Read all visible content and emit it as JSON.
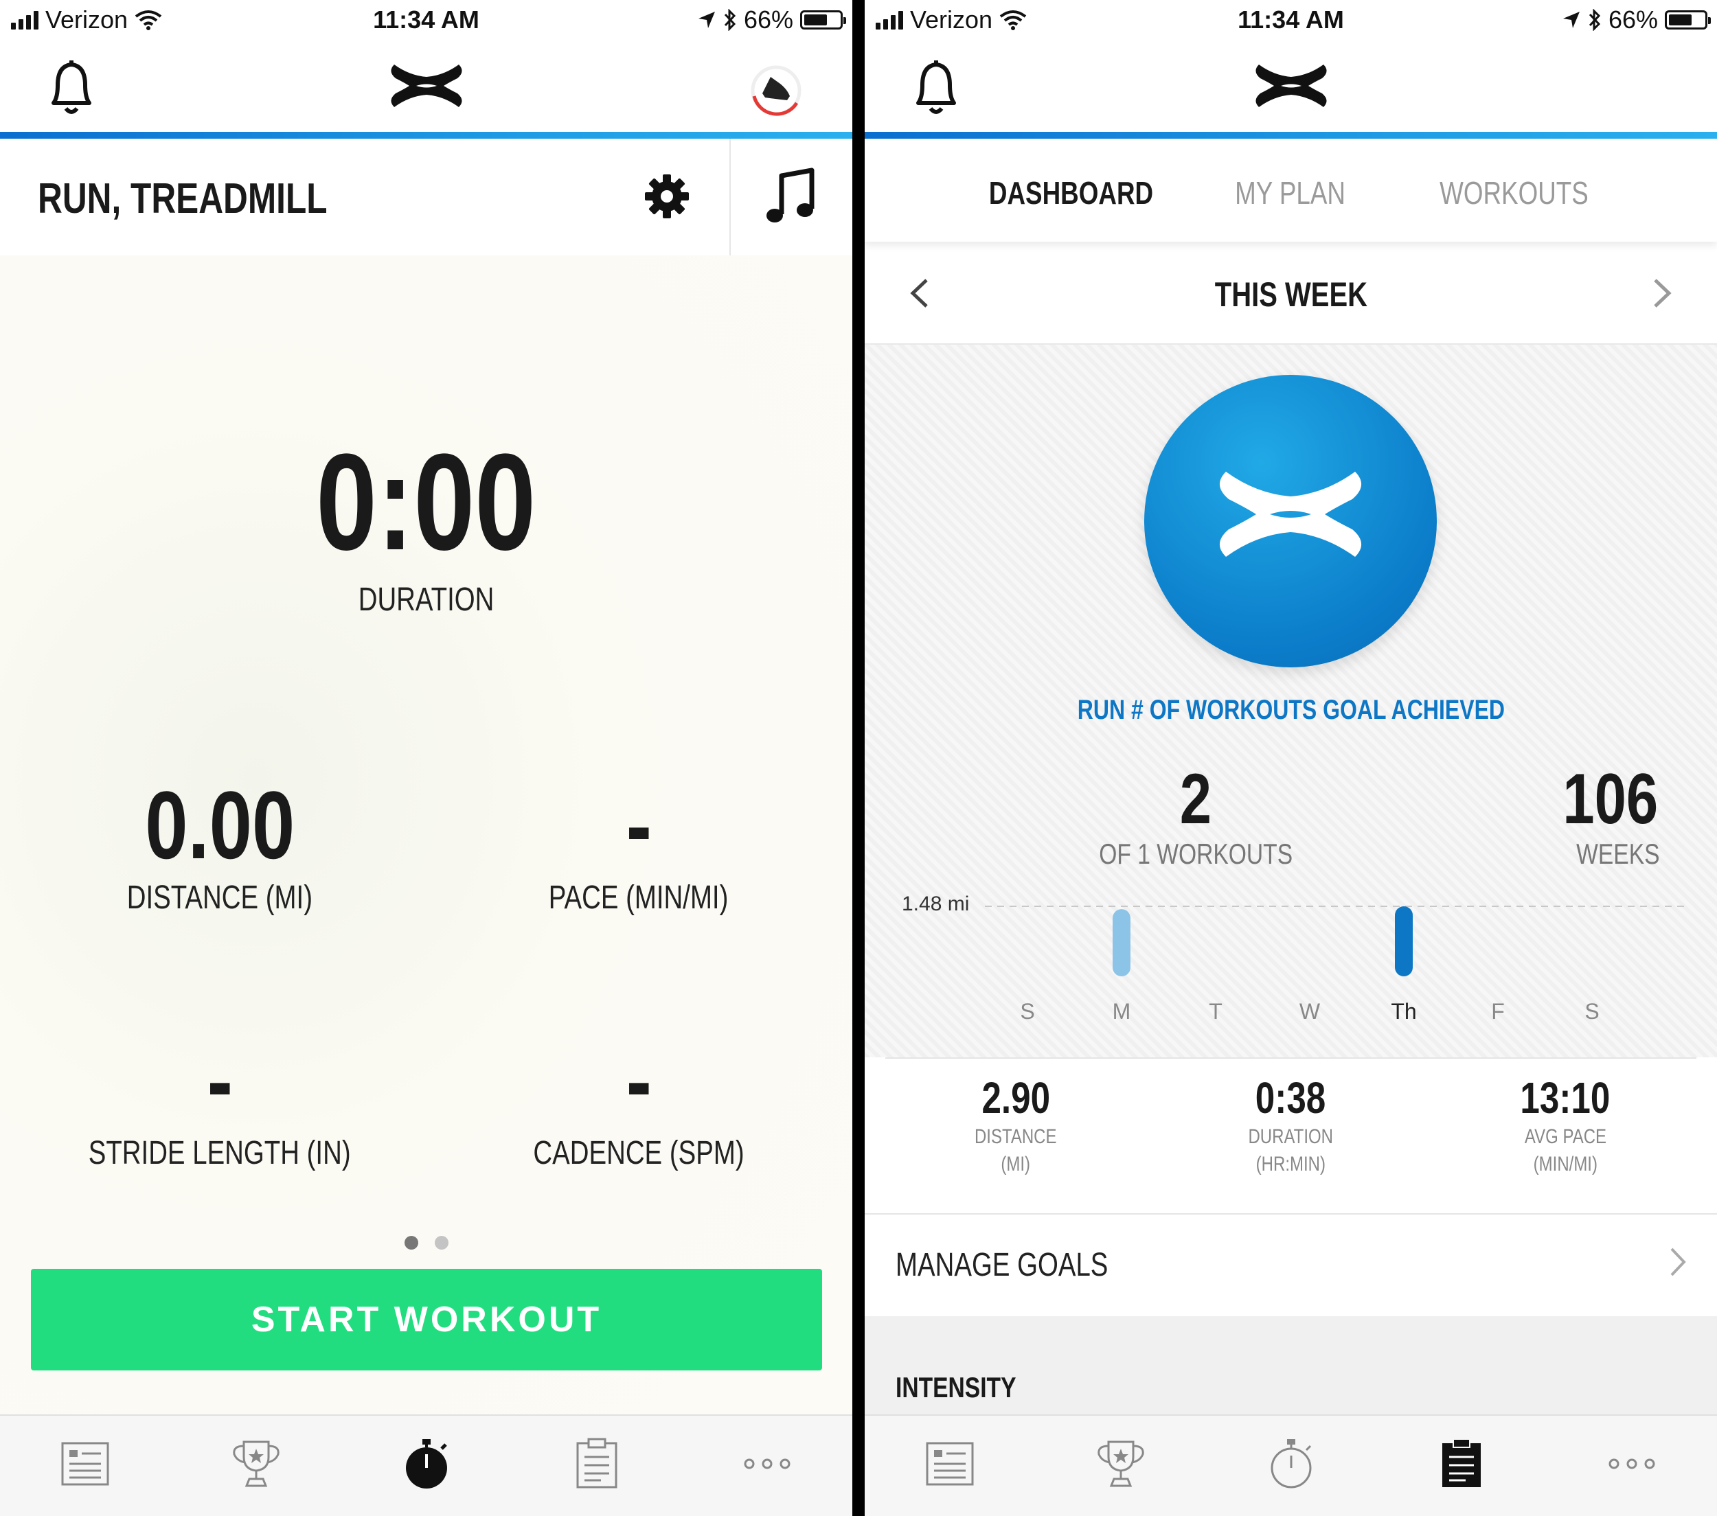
{
  "status": {
    "carrier": "Verizon",
    "time": "11:34 AM",
    "battery": "66%",
    "battery_level": 0.66
  },
  "left": {
    "title": "RUN, TREADMILL",
    "duration_value": "0:00",
    "duration_label": "DURATION",
    "distance_value": "0.00",
    "distance_label": "DISTANCE (MI)",
    "pace_value": "-",
    "pace_label": "PACE (MIN/MI)",
    "stride_value": "-",
    "stride_label": "STRIDE LENGTH (IN)",
    "cadence_value": "-",
    "cadence_label": "CADENCE (SPM)",
    "start_button": "START WORKOUT",
    "page_count": 2,
    "active_page": 1
  },
  "right": {
    "tabs": [
      "DASHBOARD",
      "MY PLAN",
      "WORKOUTS"
    ],
    "active_tab": "DASHBOARD",
    "period": "THIS WEEK",
    "goal_text": "RUN # OF WORKOUTS GOAL ACHIEVED",
    "workouts_value": "2",
    "workouts_label": "OF 1 WORKOUTS",
    "weeks_value": "106",
    "weeks_label": "WEEKS",
    "chart_max_label": "1.48 mi",
    "days": [
      "S",
      "M",
      "T",
      "W",
      "Th",
      "F",
      "S"
    ],
    "summary": {
      "distance_value": "2.90",
      "distance_label": "DISTANCE",
      "distance_unit": "(MI)",
      "duration_value": "0:38",
      "duration_label": "DURATION",
      "duration_unit": "(HR:MIN)",
      "pace_value": "13:10",
      "pace_label": "AVG PACE",
      "pace_unit": "(MIN/MI)"
    },
    "manage_goals": "MANAGE GOALS",
    "intensity": "INTENSITY"
  },
  "chart_data": {
    "type": "bar",
    "categories": [
      "S",
      "M",
      "T",
      "W",
      "Th",
      "F",
      "S"
    ],
    "values": [
      0,
      1.42,
      0,
      0,
      1.48,
      0,
      0
    ],
    "ylim": [
      0,
      1.48
    ],
    "highlight": "Th",
    "colors": {
      "normal": "#8cc4e8",
      "highlight": "#0d77c6"
    }
  },
  "colors": {
    "accent_blue": "#0d77c6",
    "start_green": "#22dd80"
  },
  "icons": {
    "left_tabs": [
      "feed-icon",
      "trophy-icon",
      "stopwatch-icon",
      "clipboard-icon",
      "more-icon"
    ],
    "active_left_tab": "stopwatch-icon",
    "active_right_tab": "clipboard-icon"
  }
}
